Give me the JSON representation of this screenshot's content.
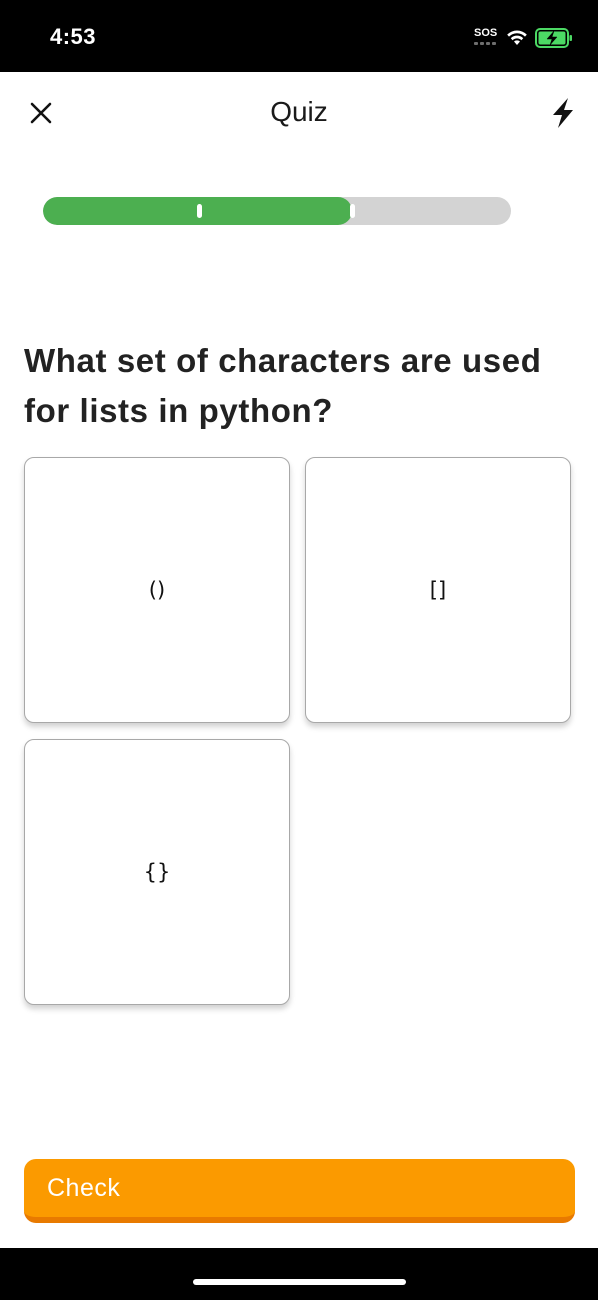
{
  "status_bar": {
    "time": "4:53",
    "sos": "SOS",
    "icons": [
      "wifi-icon",
      "battery-charging-icon"
    ]
  },
  "header": {
    "title": "Quiz",
    "close_icon": "close-icon",
    "bolt_icon": "lightning-bolt-icon"
  },
  "progress": {
    "fraction": 0.66,
    "colors": {
      "fill": "#4caf50",
      "track": "#d3d3d3"
    }
  },
  "question": {
    "text": "What set of characters are used for lists in python?"
  },
  "options": [
    {
      "label": "()"
    },
    {
      "label": "[]"
    },
    {
      "label": "{}"
    }
  ],
  "check_button": {
    "label": "Check",
    "color": "#fb9a00"
  }
}
